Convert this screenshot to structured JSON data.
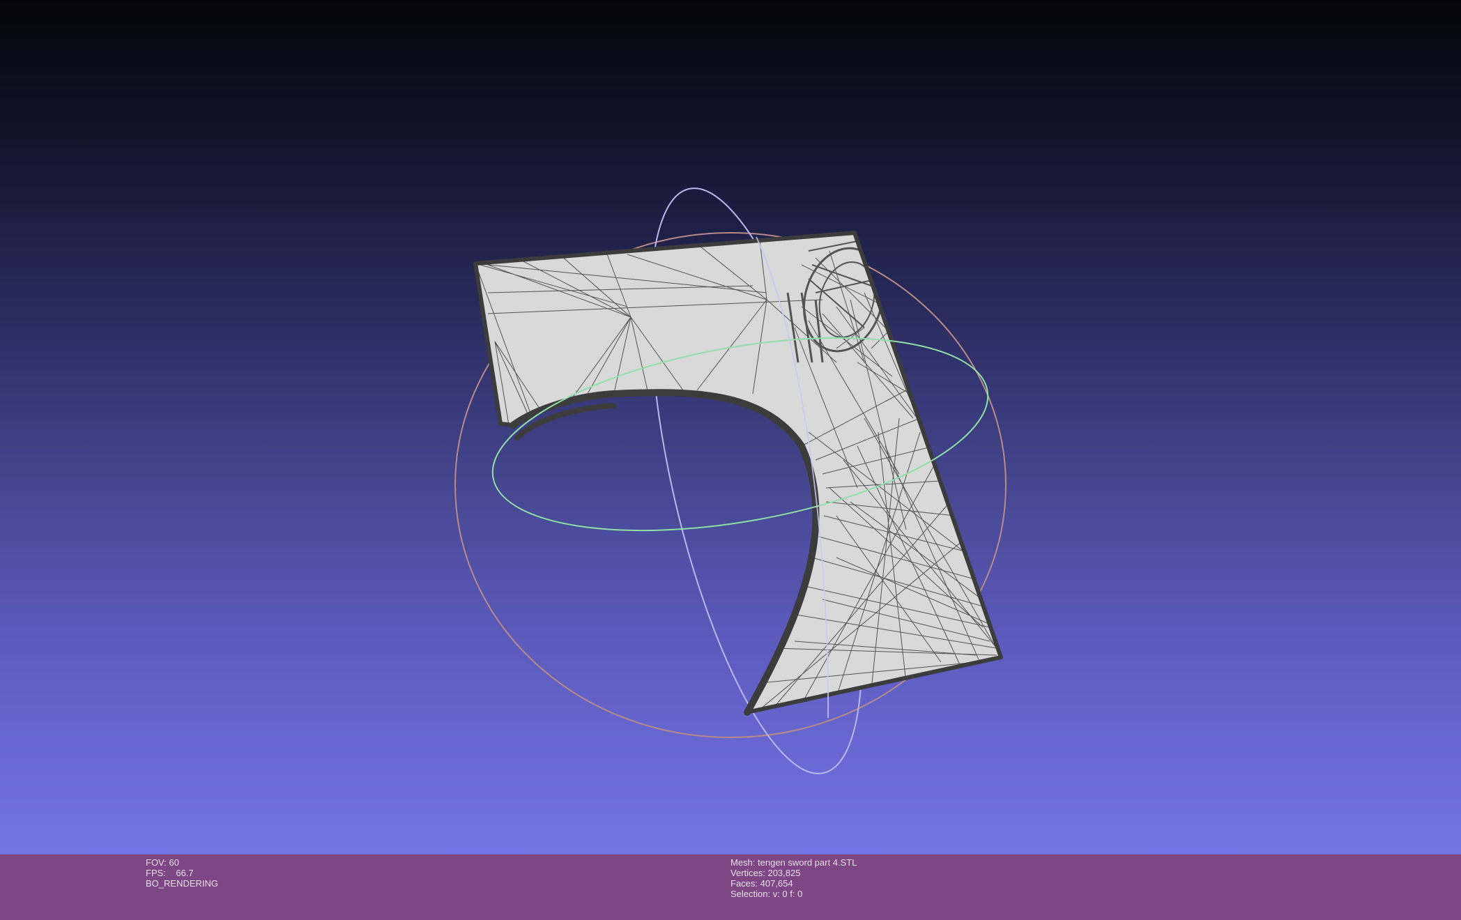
{
  "viewport": {
    "background_top": "#050508",
    "background_bottom": "#7574e6",
    "mesh_fill": "#d9d9d9",
    "mesh_edge": "#3c3c3c",
    "trackball_colors": {
      "red_ring": "#b98a8a",
      "green_ring": "#8fe0a8",
      "blue_ring": "#b8b8ee"
    }
  },
  "info_bar": {
    "background": "#7e4685",
    "left": {
      "fov": "FOV: 60",
      "fps": "FPS:    66.7",
      "render_mode": "BO_RENDERING"
    },
    "right": {
      "mesh": "Mesh: tengen sword part 4.STL",
      "vertices": "Vertices: 203,825",
      "faces": "Faces: 407,654",
      "selection": "Selection: v: 0 f: 0"
    }
  }
}
